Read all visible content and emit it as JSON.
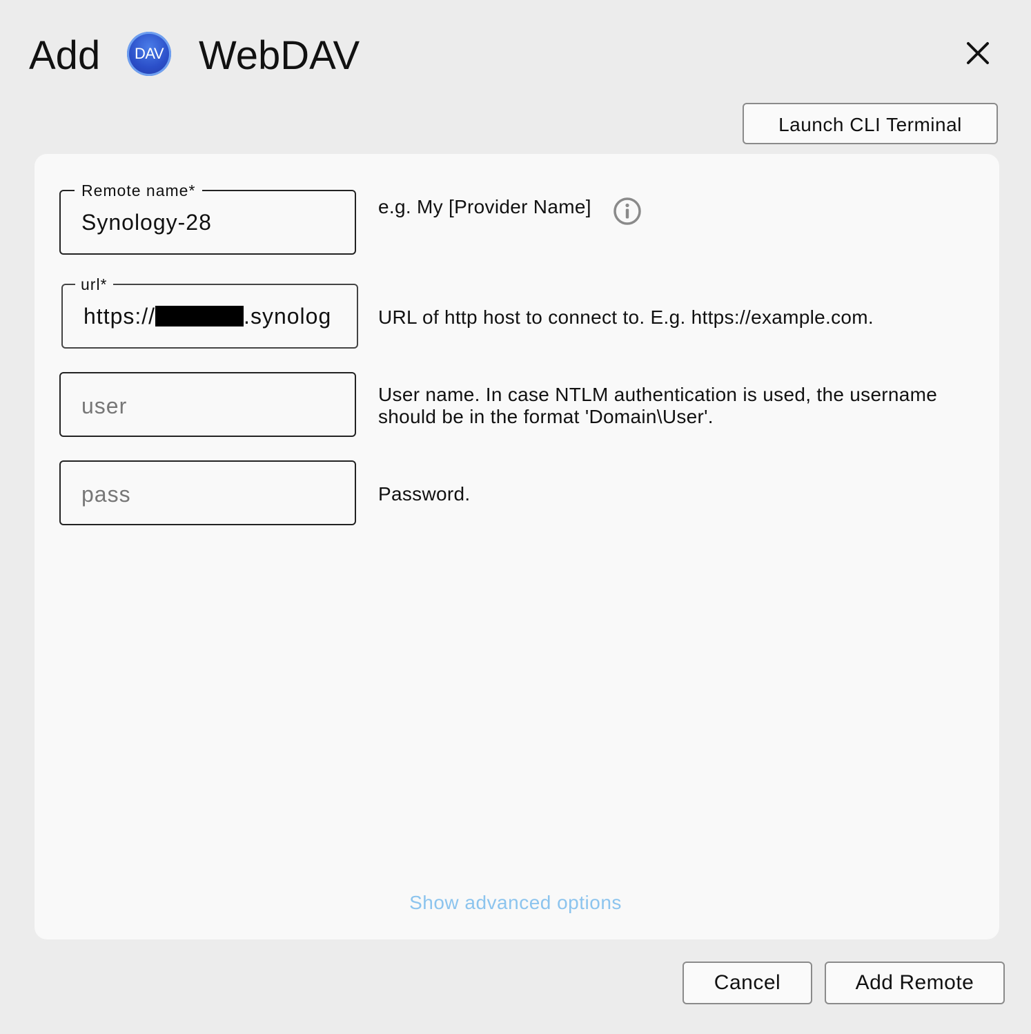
{
  "header": {
    "add_label": "Add",
    "provider_logo_text": "DAV",
    "provider_name": "WebDAV"
  },
  "toolbar": {
    "launch_cli_label": "Launch CLI Terminal"
  },
  "form": {
    "remote_name": {
      "label": "Remote name*",
      "value": "Synology-28",
      "hint": "e.g. My [Provider Name]"
    },
    "url": {
      "label": "url*",
      "value_prefix": "https://",
      "value_suffix": ".synolog",
      "hint": "URL of http host to connect to.  E.g. https://example.com."
    },
    "user": {
      "placeholder": "user",
      "hint": "User name.  In case NTLM authentication is used, the username should be in the format 'Domain\\User'."
    },
    "pass": {
      "placeholder": "pass",
      "hint": "Password."
    },
    "advanced_label": "Show advanced options"
  },
  "footer": {
    "cancel_label": "Cancel",
    "add_remote_label": "Add Remote"
  },
  "colors": {
    "background": "#ececec",
    "panel": "#f9f9f9",
    "link": "#8cc4ee",
    "logo_blue": "#2b4fc9"
  }
}
